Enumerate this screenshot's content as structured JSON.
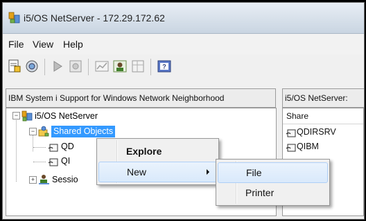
{
  "window": {
    "title": "i5/OS NetServer - 172.29.172.62"
  },
  "menubar": {
    "items": [
      "File",
      "View",
      "Help"
    ]
  },
  "toolbar": {
    "icons": [
      "properties-icon",
      "network-icon",
      "start-icon",
      "stop-icon",
      "chart-icon",
      "user-icon",
      "sheet-icon",
      "help-icon"
    ]
  },
  "left_pane": {
    "header": "IBM System i Support for Windows Network Neighborhood",
    "tree": {
      "root": "i5/OS NetServer",
      "shared_objects": "Shared Objects",
      "children": [
        "QD",
        "QI"
      ],
      "sessions": "Sessio"
    }
  },
  "right_pane": {
    "header": "i5/OS NetServer:",
    "column": "Share",
    "rows": [
      "QDIRSRV",
      "QIBM"
    ]
  },
  "context_menu": {
    "items": [
      "Explore",
      "New"
    ]
  },
  "submenu": {
    "items": [
      "File",
      "Printer"
    ]
  },
  "colors": {
    "selection": "#3399ff",
    "menu_highlight": "#d9e9fb"
  }
}
